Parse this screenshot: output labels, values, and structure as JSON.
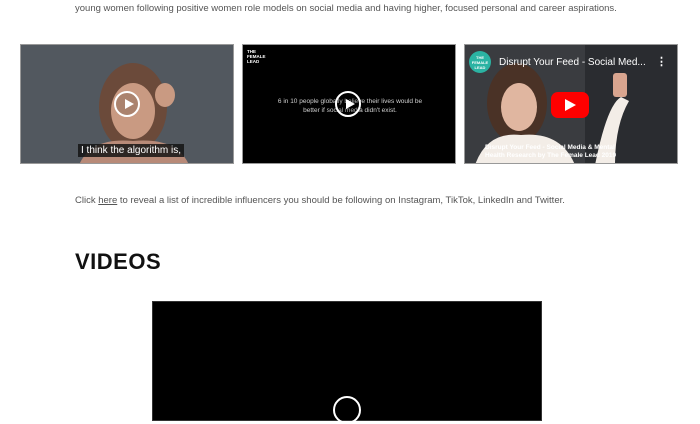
{
  "intro": {
    "text": "young women following positive women role models on social media and having higher, focused personal and career aspirations."
  },
  "videos": [
    {
      "caption": "I think the algorithm is,"
    },
    {
      "stat": "6 in 10 people globally believe their lives would be better if social media didn't exist.",
      "brand": "THE FEMALE LEAD"
    },
    {
      "logo": "THE FEMALE LEAD",
      "title": "Disrupt Your Feed - Social Med...",
      "menu": "⋮",
      "bottom_line1": "Disrupt Your Feed  - Social Media & Mental",
      "bottom_line2": "Health Research by The Female Lead 2019"
    }
  ],
  "click": {
    "prefix": "Click ",
    "link": "here",
    "suffix": " to reveal a list of incredible influencers you should be following on Instagram, TikTok, LinkedIn and Twitter."
  },
  "section": {
    "heading": "VIDEOS"
  },
  "colors": {
    "youtube_red": "#ff0000",
    "brand_teal": "#2bb3a3",
    "heading": "#111111"
  }
}
